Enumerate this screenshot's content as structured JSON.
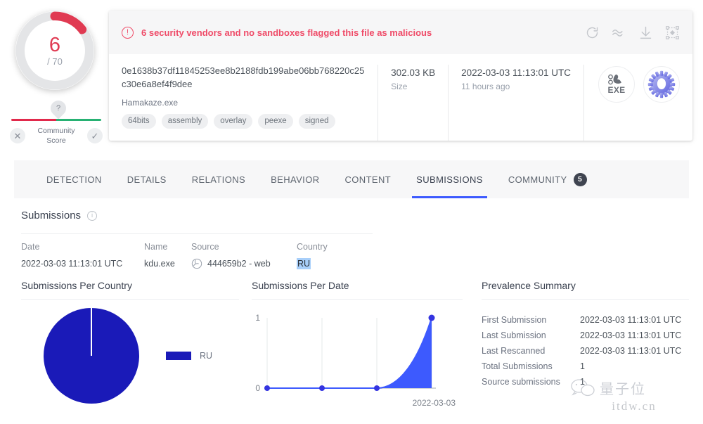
{
  "score": {
    "value": "6",
    "denominator": "/ 70",
    "ring_color": "#e03a52",
    "community": {
      "pin": "?",
      "reject_icon": "x-icon",
      "accept_icon": "check-icon",
      "label_line1": "Community",
      "label_line2": "Score"
    }
  },
  "alert": {
    "icon": "!",
    "text": "6 security vendors and no sandboxes flagged this file as malicious",
    "color": "#ef4b68",
    "actions": [
      {
        "name": "reanalyze-icon",
        "title": "Reanalyse"
      },
      {
        "name": "similar-icon",
        "title": "Similar"
      },
      {
        "name": "download-icon",
        "title": "Download"
      },
      {
        "name": "graph-icon",
        "title": "Graph"
      }
    ]
  },
  "file": {
    "hash": "0e1638b37df11845253ee8b2188fdb199abe06bb768220c25c30e6a8ef4f9dee",
    "name": "Hamakaze.exe",
    "tags": [
      "64bits",
      "assembly",
      "overlay",
      "peexe",
      "signed"
    ],
    "size_value": "302.03 KB",
    "size_label": "Size",
    "date_value": "2022-03-03 11:13:01 UTC",
    "date_label": "11 hours ago",
    "type_badge": "EXE",
    "gear_badge": "gear-icon"
  },
  "tabs": [
    {
      "label": "DETECTION",
      "active": false
    },
    {
      "label": "DETAILS",
      "active": false
    },
    {
      "label": "RELATIONS",
      "active": false
    },
    {
      "label": "BEHAVIOR",
      "active": false
    },
    {
      "label": "CONTENT",
      "active": false
    },
    {
      "label": "SUBMISSIONS",
      "active": true
    },
    {
      "label": "COMMUNITY",
      "active": false,
      "badge": "5"
    }
  ],
  "submissions": {
    "title": "Submissions",
    "columns": [
      "Date",
      "Name",
      "Source",
      "Country"
    ],
    "rows": [
      {
        "date": "2022-03-03 11:13:01 UTC",
        "name": "kdu.exe",
        "source": "444659b2 - web",
        "country": "RU"
      }
    ]
  },
  "panels": {
    "country_title": "Submissions Per Country",
    "date_title": "Submissions Per Date",
    "prevalence_title": "Prevalence Summary"
  },
  "prevalence": [
    {
      "key": "First Submission",
      "value": "2022-03-03 11:13:01 UTC"
    },
    {
      "key": "Last Submission",
      "value": "2022-03-03 11:13:01 UTC"
    },
    {
      "key": "Last Rescanned",
      "value": "2022-03-03 11:13:01 UTC"
    },
    {
      "key": "Total Submissions",
      "value": "1"
    },
    {
      "key": "Source submissions",
      "value": "1"
    }
  ],
  "watermark": {
    "cn": "量子位",
    "url": "itdw.cn",
    "icon": "wechat-icon"
  },
  "chart_data": [
    {
      "type": "pie",
      "title": "Submissions Per Country",
      "labels": [
        "RU"
      ],
      "values": [
        1
      ],
      "percentages": [
        100
      ],
      "colors": [
        "#1a1ab8"
      ],
      "legend": "right"
    },
    {
      "type": "area",
      "title": "Submissions Per Date",
      "x": [
        "",
        "",
        "",
        "2022-03-03"
      ],
      "values": [
        0,
        0,
        0,
        1
      ],
      "ylim": [
        0,
        1
      ],
      "yticks": [
        "0",
        "1"
      ],
      "xlabel": "",
      "ylabel": "",
      "grid": true,
      "color": "#3d5afe",
      "xtick_labels": [
        "2022-03-03"
      ]
    }
  ]
}
